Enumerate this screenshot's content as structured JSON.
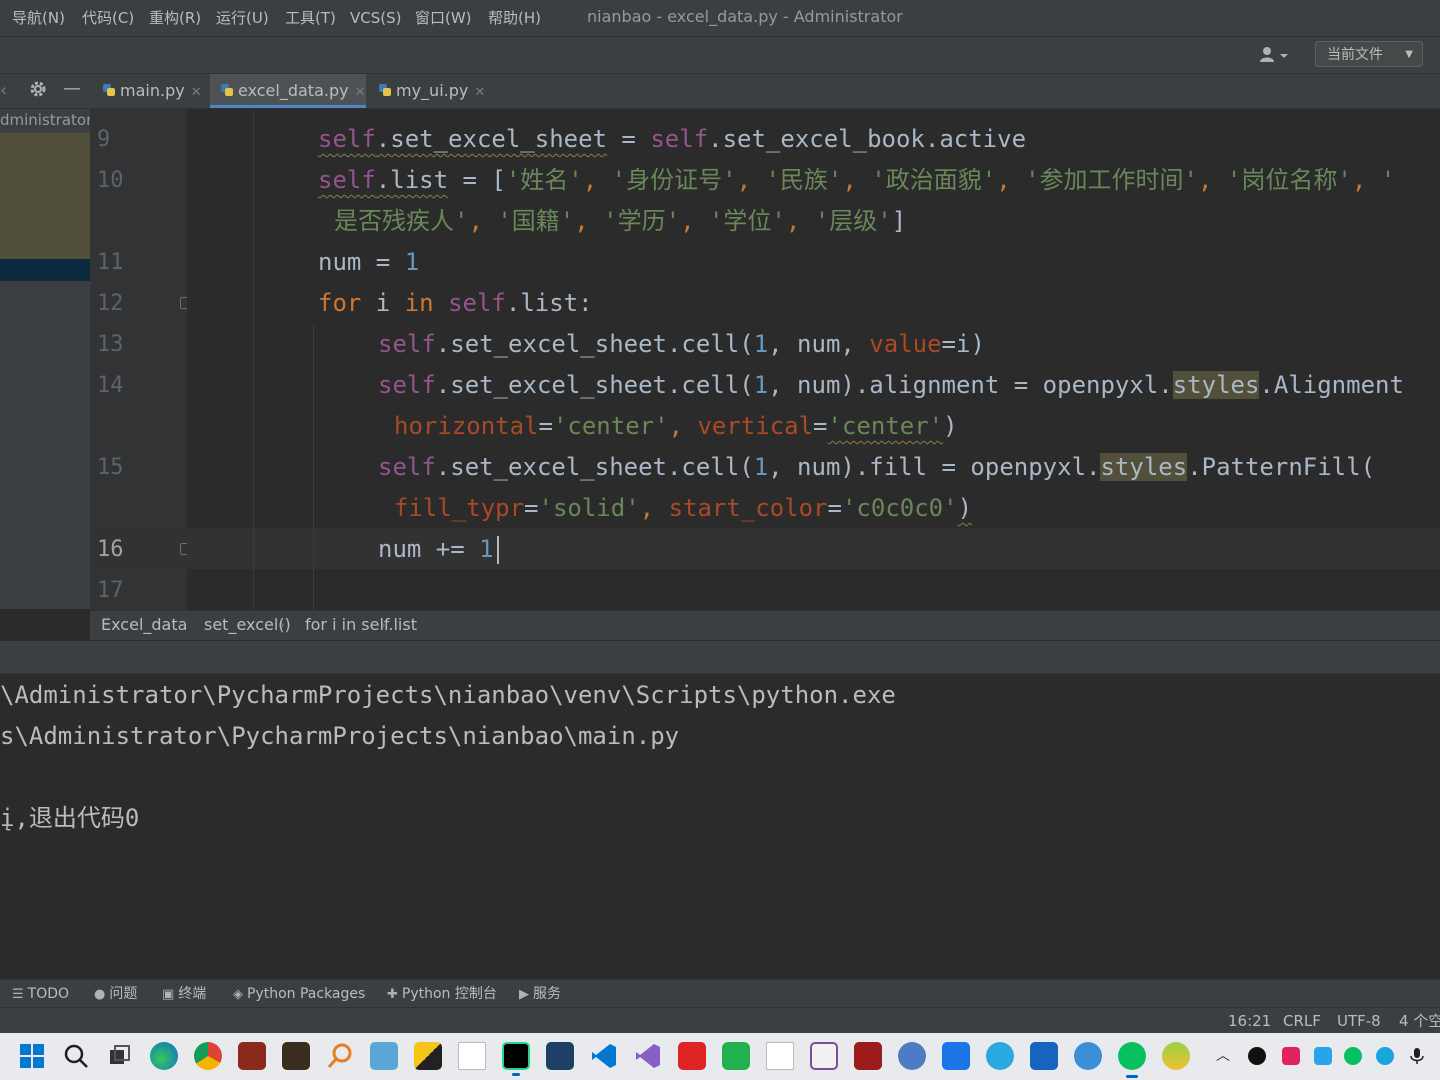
{
  "menubar": {
    "items": [
      "导航(N)",
      "代码(C)",
      "重构(R)",
      "运行(U)",
      "工具(T)",
      "VCS(S)",
      "窗口(W)",
      "帮助(H)"
    ],
    "window_title": "nianbao - excel_data.py - Administrator"
  },
  "toolbar": {
    "scope_select": "当前文件"
  },
  "tabs": [
    {
      "label": "main.py"
    },
    {
      "label": "excel_data.py"
    },
    {
      "label": "my_ui.py"
    }
  ],
  "project_panel": {
    "truncated_label": "dministrator\\"
  },
  "editor": {
    "line_numbers": [
      "9",
      "10",
      "11",
      "12",
      "13",
      "14",
      "15",
      "16",
      "17"
    ],
    "lines": {
      "l9_a": "self",
      "l9_b": ".set_excel_sheet",
      "l9_c": " = ",
      "l9_d": "self",
      "l9_e": ".set_excel_book.active",
      "l10_a": "self",
      "l10_b": ".list",
      "l10_c": " = [",
      "l10_s1": "'姓名'",
      "l10_s2": "'身份证号'",
      "l10_s3": "'民族'",
      "l10_s4": "'政治面貌'",
      "l10_s5": "'参加工作时间'",
      "l10_s6": "'岗位名称'",
      "l10_s7": "'",
      "l10w_s1": "是否残疾人'",
      "l10w_s2": "'国籍'",
      "l10w_s3": "'学历'",
      "l10w_s4": "'学位'",
      "l10w_s5": "'层级'",
      "l10w_end": "]",
      "l11_a": "num = ",
      "l11_b": "1",
      "l12_kw1": "for",
      "l12_a": " i ",
      "l12_kw2": "in",
      "l12_self": " self",
      "l12_b": ".list:",
      "l13_self": "self",
      "l13_a": ".set_excel_sheet.cell(",
      "l13_n": "1",
      "l13_b": ", num, ",
      "l13_p": "value",
      "l13_c": "=i)",
      "l14_self": "self",
      "l14_a": ".set_excel_sheet.cell(",
      "l14_n": "1",
      "l14_b": ", num).alignment = openpyxl.",
      "l14_hl": "styles",
      "l14_c": ".Alignment",
      "l14w_p1": "horizontal",
      "l14w_eq1": "=",
      "l14w_s1": "'center'",
      "l14w_comma": ", ",
      "l14w_p2": "vertical",
      "l14w_eq2": "=",
      "l14w_s2": "'center'",
      "l14w_end": ")",
      "l15_self": "self",
      "l15_a": ".set_excel_sheet.cell(",
      "l15_n": "1",
      "l15_b": ", num).fill = openpyxl.",
      "l15_hl": "styles",
      "l15_c": ".PatternFill(",
      "l15w_p1": "fill_typr",
      "l15w_eq1": "=",
      "l15w_s1": "'solid'",
      "l15w_comma": ", ",
      "l15w_p2": "start_color",
      "l15w_eq2": "=",
      "l15w_s2": "'c0c0c0'",
      "l15w_end": ")",
      "l16_a": "num += ",
      "l16_n": "1",
      "comma": ", "
    }
  },
  "breadcrumb": [
    "Excel_data",
    "set_excel()",
    "for i in self.list"
  ],
  "run_output": [
    "\\Administrator\\PycharmProjects\\nianbao\\venv\\Scripts\\python.exe",
    "s\\Administrator\\PycharmProjects\\nianbao\\main.py",
    "",
    "į,退出代码0"
  ],
  "tool_windows": [
    {
      "icon": "list-icon",
      "label": "TODO"
    },
    {
      "icon": "problems-icon",
      "label": "问题"
    },
    {
      "icon": "terminal-icon",
      "label": "终端"
    },
    {
      "icon": "packages-icon",
      "label": "Python Packages"
    },
    {
      "icon": "python-console-icon",
      "label": "Python 控制台"
    },
    {
      "icon": "services-icon",
      "label": "服务"
    }
  ],
  "statusbar": {
    "position": "16:21",
    "line_ending": "CRLF",
    "encoding": "UTF-8",
    "indent": "4 个空"
  },
  "colors": {
    "keyword": "#cc7832",
    "self": "#94558d",
    "string": "#6a8759",
    "number": "#6897bb",
    "param": "#aa4926",
    "accent": "#4a88c7"
  }
}
